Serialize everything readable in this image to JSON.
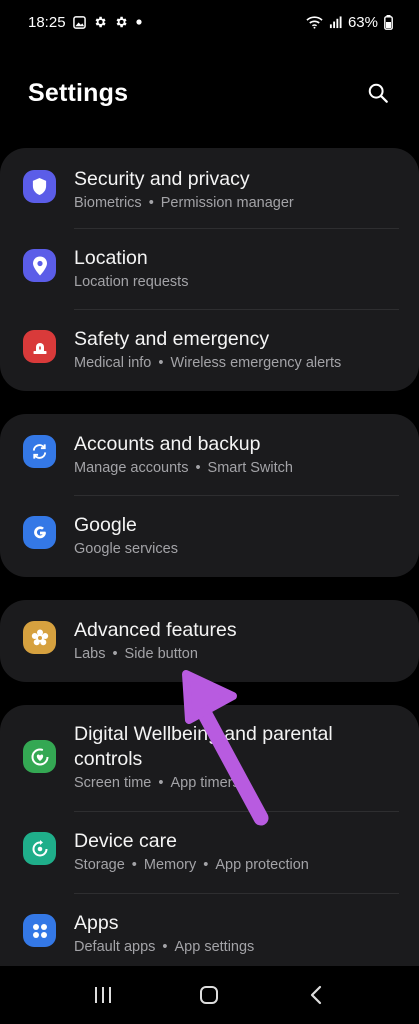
{
  "status": {
    "time": "18:25",
    "battery": "63%"
  },
  "header": {
    "title": "Settings"
  },
  "groups": [
    {
      "items": [
        {
          "title": "Security and privacy",
          "subs": [
            "Biometrics",
            "Permission manager"
          ],
          "icon": "shield-icon",
          "color": "#5b5de8"
        },
        {
          "title": "Location",
          "subs": [
            "Location requests"
          ],
          "icon": "location-pin-icon",
          "color": "#5b5de8"
        },
        {
          "title": "Safety and emergency",
          "subs": [
            "Medical info",
            "Wireless emergency alerts"
          ],
          "icon": "emergency-alert-icon",
          "color": "#d93a3a"
        }
      ]
    },
    {
      "items": [
        {
          "title": "Accounts and backup",
          "subs": [
            "Manage accounts",
            "Smart Switch"
          ],
          "icon": "sync-icon",
          "color": "#3478e6"
        },
        {
          "title": "Google",
          "subs": [
            "Google services"
          ],
          "icon": "google-icon",
          "color": "#3478e6"
        }
      ]
    },
    {
      "items": [
        {
          "title": "Advanced features",
          "subs": [
            "Labs",
            "Side button"
          ],
          "icon": "gear-flower-icon",
          "color": "#d6a13f"
        }
      ]
    },
    {
      "items": [
        {
          "title": "Digital Wellbeing and parental controls",
          "subs": [
            "Screen time",
            "App timers"
          ],
          "icon": "wellbeing-icon",
          "color": "#34a853"
        },
        {
          "title": "Device care",
          "subs": [
            "Storage",
            "Memory",
            "App protection"
          ],
          "icon": "device-care-icon",
          "color": "#1fae8a"
        },
        {
          "title": "Apps",
          "subs": [
            "Default apps",
            "App settings"
          ],
          "icon": "apps-grid-icon",
          "color": "#3478e6"
        }
      ]
    }
  ],
  "annotation": {
    "arrow_color": "#b85be0"
  }
}
